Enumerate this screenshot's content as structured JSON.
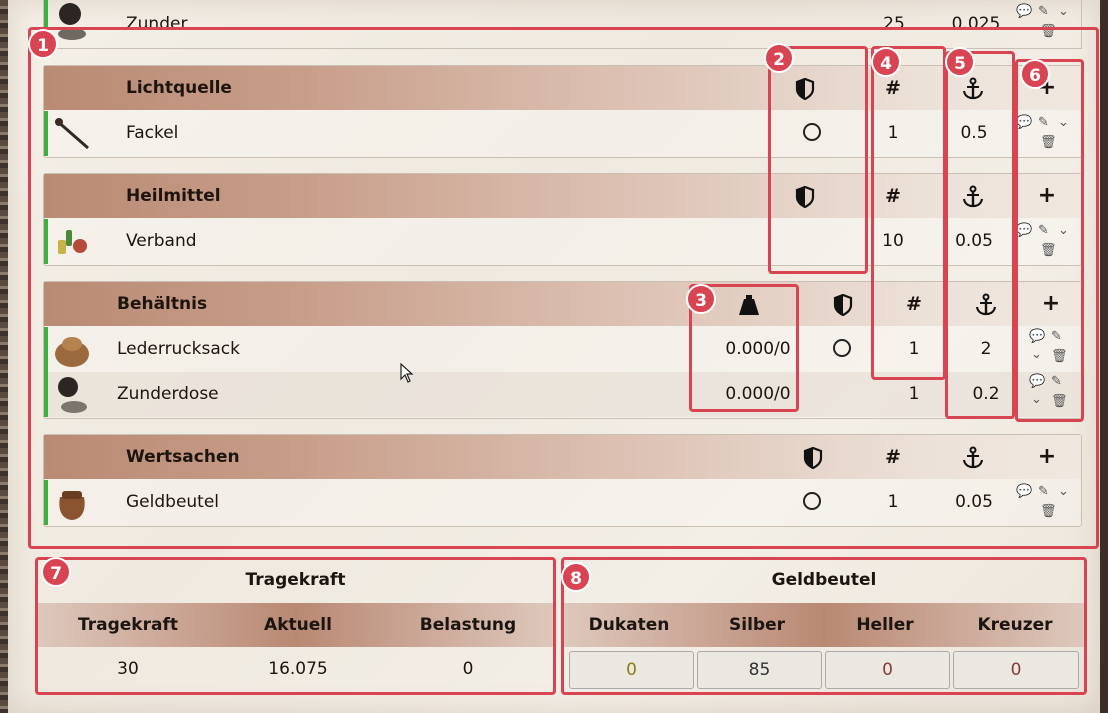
{
  "top_row": {
    "name": "Zunder",
    "count": "25",
    "weight": "0.025"
  },
  "groups": [
    {
      "title": "Lichtquelle",
      "col_shield": "shield-icon",
      "col_count": "#",
      "col_weight": "anchor-icon",
      "add": "+",
      "items": [
        {
          "name": "Fackel",
          "equipped": "",
          "count": "1",
          "weight": "0.5"
        }
      ]
    },
    {
      "title": "Heilmittel",
      "col_shield": "shield-icon",
      "col_count": "#",
      "col_weight": "anchor-icon",
      "add": "+",
      "items": [
        {
          "name": "Verband",
          "count": "10",
          "weight": "0.05"
        }
      ]
    },
    {
      "title": "Behältnis",
      "col_capacity": "bag-icon",
      "col_shield": "shield-icon",
      "col_count": "#",
      "col_weight": "anchor-icon",
      "add": "+",
      "items": [
        {
          "name": "Lederrucksack",
          "capacity": "0.000/0",
          "count": "1",
          "weight": "2"
        },
        {
          "name": "Zunderdose",
          "capacity": "0.000/0",
          "count": "1",
          "weight": "0.2"
        }
      ]
    },
    {
      "title": "Wertsachen",
      "col_shield": "shield-icon",
      "col_count": "#",
      "col_weight": "anchor-icon",
      "add": "+",
      "items": [
        {
          "name": "Geldbeutel",
          "count": "1",
          "weight": "0.05"
        }
      ]
    }
  ],
  "tragekraft": {
    "title": "Tragekraft",
    "headers": [
      "Tragekraft",
      "Aktuell",
      "Belastung"
    ],
    "values": [
      "30",
      "16.075",
      "0"
    ]
  },
  "geldbeutel": {
    "title": "Geldbeutel",
    "headers": [
      "Dukaten",
      "Silber",
      "Heller",
      "Kreuzer"
    ],
    "values": [
      "0",
      "85",
      "0",
      "0"
    ],
    "colors": [
      "#8b7d1a",
      "#333333",
      "#8a3a3a",
      "#8a3a3a"
    ]
  },
  "annotations": [
    "1",
    "2",
    "3",
    "4",
    "5",
    "6",
    "7",
    "8"
  ]
}
